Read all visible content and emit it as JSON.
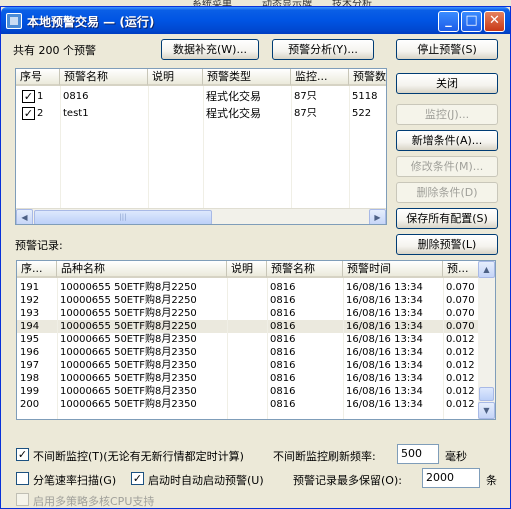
{
  "background_tabs": [
    "系统菜单",
    "动态显示牌",
    "技术分析"
  ],
  "window": {
    "title": "本地预警交易 — (运行)",
    "min_icon": "minimize-icon",
    "max_icon": "maximize-icon",
    "close_icon": "close-icon"
  },
  "summary": {
    "prefix": "共有",
    "count": "200",
    "suffix": "个预警"
  },
  "buttons": {
    "data_fill": "数据补充(W)...",
    "alert_analysis": "预警分析(Y)...",
    "stop_alert": "停止预警(S)",
    "close": "关闭",
    "monitor": "监控(J)...",
    "add_condition": "新增条件(A)...",
    "edit_condition": "修改条件(M)...",
    "delete_condition": "删除条件(D)",
    "save_all": "保存所有配置(S)",
    "delete_alerts": "删除预警(L)"
  },
  "conditions_table": {
    "columns": [
      "序号",
      "预警名称",
      "说明",
      "预警类型",
      "监控...",
      "预警数"
    ],
    "rows": [
      {
        "checked": true,
        "no": "1",
        "name": "0816",
        "desc": "",
        "type": "程式化交易",
        "monitor": "87只",
        "count": "5118"
      },
      {
        "checked": true,
        "no": "2",
        "name": "test1",
        "desc": "",
        "type": "程式化交易",
        "monitor": "87只",
        "count": "522"
      }
    ]
  },
  "records_label": "预警记录:",
  "records_table": {
    "columns": [
      "序...",
      "品种名称",
      "说明",
      "预警名称",
      "预警时间",
      "预..."
    ],
    "rows": [
      {
        "no": "191",
        "name": "10000655 50ETF购8月2250",
        "desc": "",
        "alert": "0816",
        "time": "16/08/16  13:34",
        "price": "0.070"
      },
      {
        "no": "192",
        "name": "10000655 50ETF购8月2250",
        "desc": "",
        "alert": "0816",
        "time": "16/08/16  13:34",
        "price": "0.070"
      },
      {
        "no": "193",
        "name": "10000655 50ETF购8月2250",
        "desc": "",
        "alert": "0816",
        "time": "16/08/16  13:34",
        "price": "0.070"
      },
      {
        "no": "194",
        "name": "10000655 50ETF购8月2250",
        "desc": "",
        "alert": "0816",
        "time": "16/08/16  13:34",
        "price": "0.070"
      },
      {
        "no": "195",
        "name": "10000665 50ETF购8月2350",
        "desc": "",
        "alert": "0816",
        "time": "16/08/16  13:34",
        "price": "0.012"
      },
      {
        "no": "196",
        "name": "10000665 50ETF购8月2350",
        "desc": "",
        "alert": "0816",
        "time": "16/08/16  13:34",
        "price": "0.012"
      },
      {
        "no": "197",
        "name": "10000665 50ETF购8月2350",
        "desc": "",
        "alert": "0816",
        "time": "16/08/16  13:34",
        "price": "0.012"
      },
      {
        "no": "198",
        "name": "10000665 50ETF购8月2350",
        "desc": "",
        "alert": "0816",
        "time": "16/08/16  13:34",
        "price": "0.012"
      },
      {
        "no": "199",
        "name": "10000665 50ETF购8月2350",
        "desc": "",
        "alert": "0816",
        "time": "16/08/16  13:34",
        "price": "0.012"
      },
      {
        "no": "200",
        "name": "10000665 50ETF购8月2350",
        "desc": "",
        "alert": "0816",
        "time": "16/08/16  13:34",
        "price": "0.012"
      }
    ]
  },
  "options": {
    "continuous_monitor": {
      "checked": true,
      "label": "不间断监控(T)(无论有无新行情都定时计算)"
    },
    "refresh_label": "不间断监控刷新频率:",
    "refresh_value": "500",
    "refresh_unit": "毫秒",
    "tick_scan": {
      "checked": false,
      "label": "分笔速率扫描(G)"
    },
    "auto_start": {
      "checked": true,
      "label": "启动时自动启动预警(U)"
    },
    "max_records_label": "预警记录最多保留(O):",
    "max_records_value": "2000",
    "max_records_unit": "条",
    "multi_cpu": {
      "checked": false,
      "label": "启用多策略多核CPU支持"
    }
  }
}
